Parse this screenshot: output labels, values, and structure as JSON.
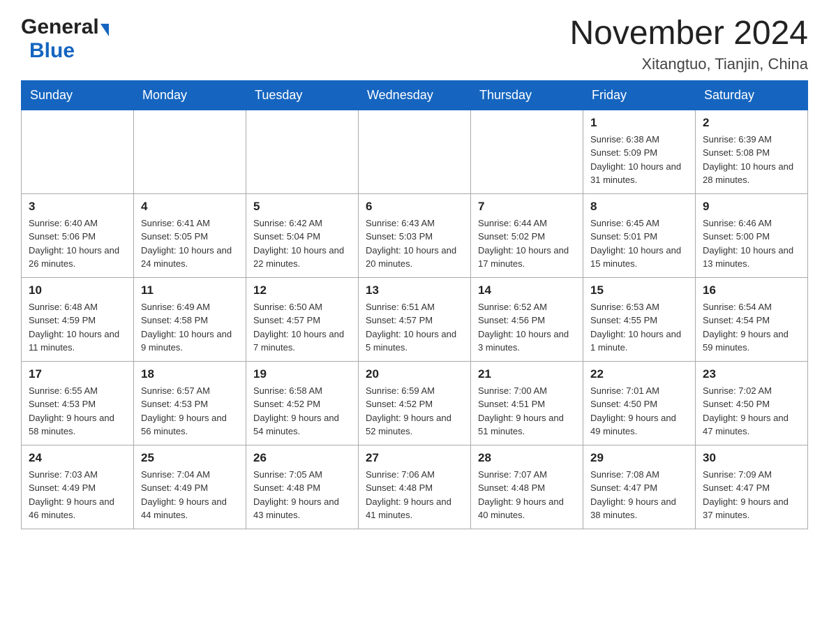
{
  "header": {
    "logo_general": "General",
    "logo_blue": "Blue",
    "title": "November 2024",
    "subtitle": "Xitangtuo, Tianjin, China"
  },
  "calendar": {
    "days_of_week": [
      "Sunday",
      "Monday",
      "Tuesday",
      "Wednesday",
      "Thursday",
      "Friday",
      "Saturday"
    ],
    "weeks": [
      [
        {
          "day": "",
          "info": ""
        },
        {
          "day": "",
          "info": ""
        },
        {
          "day": "",
          "info": ""
        },
        {
          "day": "",
          "info": ""
        },
        {
          "day": "",
          "info": ""
        },
        {
          "day": "1",
          "info": "Sunrise: 6:38 AM\nSunset: 5:09 PM\nDaylight: 10 hours and 31 minutes."
        },
        {
          "day": "2",
          "info": "Sunrise: 6:39 AM\nSunset: 5:08 PM\nDaylight: 10 hours and 28 minutes."
        }
      ],
      [
        {
          "day": "3",
          "info": "Sunrise: 6:40 AM\nSunset: 5:06 PM\nDaylight: 10 hours and 26 minutes."
        },
        {
          "day": "4",
          "info": "Sunrise: 6:41 AM\nSunset: 5:05 PM\nDaylight: 10 hours and 24 minutes."
        },
        {
          "day": "5",
          "info": "Sunrise: 6:42 AM\nSunset: 5:04 PM\nDaylight: 10 hours and 22 minutes."
        },
        {
          "day": "6",
          "info": "Sunrise: 6:43 AM\nSunset: 5:03 PM\nDaylight: 10 hours and 20 minutes."
        },
        {
          "day": "7",
          "info": "Sunrise: 6:44 AM\nSunset: 5:02 PM\nDaylight: 10 hours and 17 minutes."
        },
        {
          "day": "8",
          "info": "Sunrise: 6:45 AM\nSunset: 5:01 PM\nDaylight: 10 hours and 15 minutes."
        },
        {
          "day": "9",
          "info": "Sunrise: 6:46 AM\nSunset: 5:00 PM\nDaylight: 10 hours and 13 minutes."
        }
      ],
      [
        {
          "day": "10",
          "info": "Sunrise: 6:48 AM\nSunset: 4:59 PM\nDaylight: 10 hours and 11 minutes."
        },
        {
          "day": "11",
          "info": "Sunrise: 6:49 AM\nSunset: 4:58 PM\nDaylight: 10 hours and 9 minutes."
        },
        {
          "day": "12",
          "info": "Sunrise: 6:50 AM\nSunset: 4:57 PM\nDaylight: 10 hours and 7 minutes."
        },
        {
          "day": "13",
          "info": "Sunrise: 6:51 AM\nSunset: 4:57 PM\nDaylight: 10 hours and 5 minutes."
        },
        {
          "day": "14",
          "info": "Sunrise: 6:52 AM\nSunset: 4:56 PM\nDaylight: 10 hours and 3 minutes."
        },
        {
          "day": "15",
          "info": "Sunrise: 6:53 AM\nSunset: 4:55 PM\nDaylight: 10 hours and 1 minute."
        },
        {
          "day": "16",
          "info": "Sunrise: 6:54 AM\nSunset: 4:54 PM\nDaylight: 9 hours and 59 minutes."
        }
      ],
      [
        {
          "day": "17",
          "info": "Sunrise: 6:55 AM\nSunset: 4:53 PM\nDaylight: 9 hours and 58 minutes."
        },
        {
          "day": "18",
          "info": "Sunrise: 6:57 AM\nSunset: 4:53 PM\nDaylight: 9 hours and 56 minutes."
        },
        {
          "day": "19",
          "info": "Sunrise: 6:58 AM\nSunset: 4:52 PM\nDaylight: 9 hours and 54 minutes."
        },
        {
          "day": "20",
          "info": "Sunrise: 6:59 AM\nSunset: 4:52 PM\nDaylight: 9 hours and 52 minutes."
        },
        {
          "day": "21",
          "info": "Sunrise: 7:00 AM\nSunset: 4:51 PM\nDaylight: 9 hours and 51 minutes."
        },
        {
          "day": "22",
          "info": "Sunrise: 7:01 AM\nSunset: 4:50 PM\nDaylight: 9 hours and 49 minutes."
        },
        {
          "day": "23",
          "info": "Sunrise: 7:02 AM\nSunset: 4:50 PM\nDaylight: 9 hours and 47 minutes."
        }
      ],
      [
        {
          "day": "24",
          "info": "Sunrise: 7:03 AM\nSunset: 4:49 PM\nDaylight: 9 hours and 46 minutes."
        },
        {
          "day": "25",
          "info": "Sunrise: 7:04 AM\nSunset: 4:49 PM\nDaylight: 9 hours and 44 minutes."
        },
        {
          "day": "26",
          "info": "Sunrise: 7:05 AM\nSunset: 4:48 PM\nDaylight: 9 hours and 43 minutes."
        },
        {
          "day": "27",
          "info": "Sunrise: 7:06 AM\nSunset: 4:48 PM\nDaylight: 9 hours and 41 minutes."
        },
        {
          "day": "28",
          "info": "Sunrise: 7:07 AM\nSunset: 4:48 PM\nDaylight: 9 hours and 40 minutes."
        },
        {
          "day": "29",
          "info": "Sunrise: 7:08 AM\nSunset: 4:47 PM\nDaylight: 9 hours and 38 minutes."
        },
        {
          "day": "30",
          "info": "Sunrise: 7:09 AM\nSunset: 4:47 PM\nDaylight: 9 hours and 37 minutes."
        }
      ]
    ]
  }
}
